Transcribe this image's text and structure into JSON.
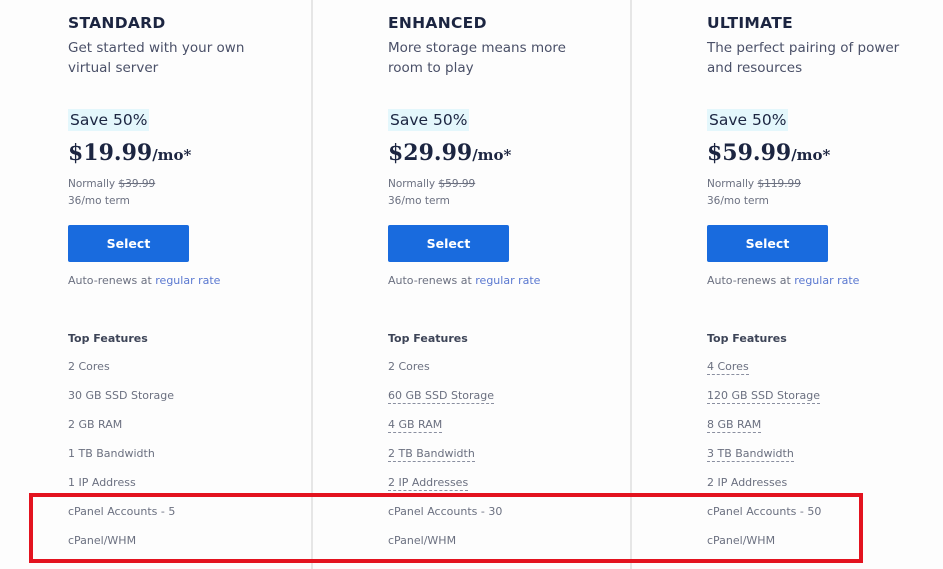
{
  "plans": [
    {
      "name": "STANDARD",
      "description": "Get started with your own virtual server",
      "save_badge": "Save 50%",
      "price": "$19.99",
      "price_unit": "/mo*",
      "normally_label": "Normally",
      "normally_price": "$39.99",
      "term": "36/mo term",
      "select_label": "Select",
      "autorenew_text": "Auto-renews at",
      "autorenew_link": "regular rate",
      "features_heading": "Top Features",
      "features": [
        {
          "label": "2 Cores",
          "tooltip": false
        },
        {
          "label": "30 GB SSD Storage",
          "tooltip": false
        },
        {
          "label": "2 GB RAM",
          "tooltip": false
        },
        {
          "label": "1 TB Bandwidth",
          "tooltip": false
        },
        {
          "label": "1 IP Address",
          "tooltip": false
        },
        {
          "label": "cPanel Accounts - 5",
          "tooltip": false
        },
        {
          "label": "cPanel/WHM",
          "tooltip": false
        }
      ]
    },
    {
      "name": "ENHANCED",
      "description": "More storage means more room to play",
      "save_badge": "Save 50%",
      "price": "$29.99",
      "price_unit": "/mo*",
      "normally_label": "Normally",
      "normally_price": "$59.99",
      "term": "36/mo term",
      "select_label": "Select",
      "autorenew_text": "Auto-renews at",
      "autorenew_link": "regular rate",
      "features_heading": "Top Features",
      "features": [
        {
          "label": "2 Cores",
          "tooltip": false
        },
        {
          "label": "60 GB SSD Storage",
          "tooltip": true
        },
        {
          "label": "4 GB RAM",
          "tooltip": true
        },
        {
          "label": "2 TB Bandwidth",
          "tooltip": true
        },
        {
          "label": "2 IP Addresses",
          "tooltip": true
        },
        {
          "label": "cPanel Accounts - 30",
          "tooltip": false
        },
        {
          "label": "cPanel/WHM",
          "tooltip": false
        }
      ]
    },
    {
      "name": "ULTIMATE",
      "description": "The perfect pairing of power and resources",
      "save_badge": "Save 50%",
      "price": "$59.99",
      "price_unit": "/mo*",
      "normally_label": "Normally",
      "normally_price": "$119.99",
      "term": "36/mo term",
      "select_label": "Select",
      "autorenew_text": "Auto-renews at",
      "autorenew_link": "regular rate",
      "features_heading": "Top Features",
      "features": [
        {
          "label": "4 Cores",
          "tooltip": true
        },
        {
          "label": "120 GB SSD Storage",
          "tooltip": true
        },
        {
          "label": "8 GB RAM",
          "tooltip": true
        },
        {
          "label": "3 TB Bandwidth",
          "tooltip": true
        },
        {
          "label": "2 IP Addresses",
          "tooltip": false
        },
        {
          "label": "cPanel Accounts - 50",
          "tooltip": false
        },
        {
          "label": "cPanel/WHM",
          "tooltip": false
        }
      ]
    }
  ],
  "colors": {
    "select_button": "#196bde",
    "save_badge_bg": "#e4f7fc",
    "link": "#5a78d0",
    "highlight_box": "#e3131f"
  }
}
